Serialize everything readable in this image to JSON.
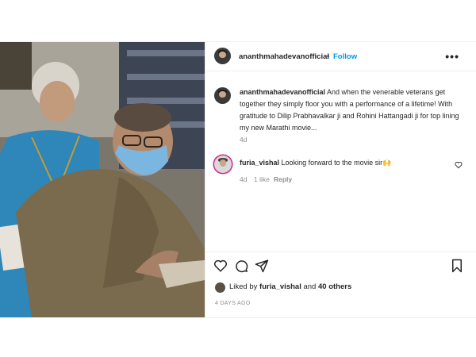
{
  "post": {
    "author": "ananthmahadevanofficial",
    "separator": "•",
    "follow_label": "Follow",
    "more_label": "•••",
    "caption_text": "And when the venerable veterans get together they simply floor you with a performance of a lifetime! With gratitude to Dilip Prabhavalkar ji and Rohini Hattangadi ji for top lining my new Marathi movie...",
    "caption_age": "4d"
  },
  "comment": {
    "username": "furia_vishal",
    "text": "Looking forward to the movie sir🙌",
    "age": "4d",
    "likes": "1 like",
    "reply_label": "Reply"
  },
  "likes": {
    "prefix": "Liked by",
    "user": "furia_vishal",
    "joiner": "and",
    "others": "40 others"
  },
  "timestamp": "4 DAYS AGO",
  "icons": [
    "heart-icon",
    "comment-icon",
    "share-icon",
    "bookmark-icon",
    "more-options-icon"
  ]
}
